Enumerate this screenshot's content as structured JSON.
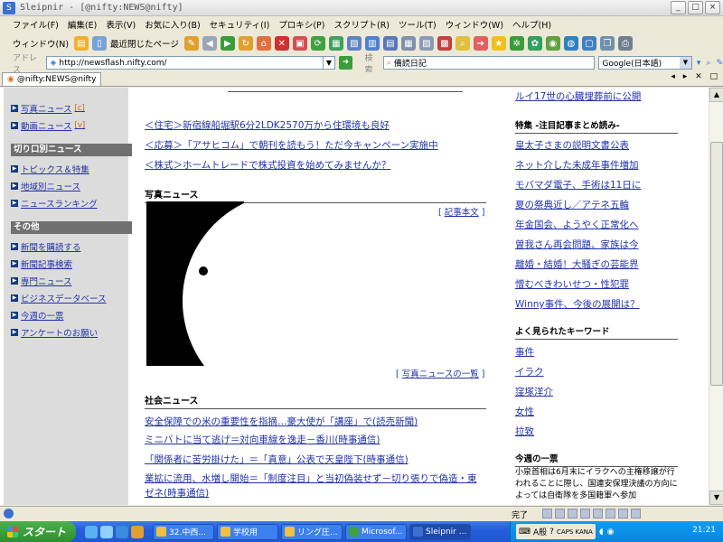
{
  "window": {
    "title": "Sleipnir - [@nifty:NEWS@nifty]",
    "controls": [
      "_",
      "□",
      "×"
    ]
  },
  "menu": [
    "ファイル(F)",
    "編集(E)",
    "表示(V)",
    "お気に入り(B)",
    "セキュリティ(I)",
    "プロキシ(P)",
    "スクリプト(R)",
    "ツール(T)",
    "ウィンドウ(W)",
    "ヘルプ(H)"
  ],
  "toolbar": {
    "window_label": "ウィンドウ(N)",
    "recently_closed_label": "最近閉じたページ"
  },
  "address": {
    "label": "アドレス",
    "url": "http://newsflash.nifty.com/",
    "search_label": "検索",
    "search_value": "備読日記",
    "engine": "Google(日本語)"
  },
  "tab": {
    "label": "@nifty:NEWS@nifty",
    "nav": "◂ ▸ ✕ □"
  },
  "sidebar": {
    "top_links": [
      {
        "label": "写真ニュース",
        "tag": "[c]"
      },
      {
        "label": "動画ニュース",
        "tag": "[v]"
      }
    ],
    "section1_title": "切り口別ニュース",
    "section1_links": [
      "トピックス＆特集",
      "地域別ニュース",
      "ニュースランキング"
    ],
    "section2_title": "その他",
    "section2_links": [
      "新聞を購読する",
      "新聞記事検索",
      "専門ニュース",
      "ビジネスデータベース",
      "今週の一票",
      "アンケートのお願い"
    ]
  },
  "main": {
    "promos": [
      {
        "tag": "＜住宅＞",
        "text": "新宿線船堀駅6分2LDK2570万から住環境も良好"
      },
      {
        "tag": "＜応募＞",
        "text": "「アサヒコム」で朝刊を読もう！ただ今キャンペーン実施中"
      },
      {
        "tag": "＜株式＞",
        "text": "ホームトレードで株式投資を始めてみませんか？"
      }
    ],
    "photo_title": "写真ニュース",
    "article_link": "記事本文",
    "photo_list_link": "写真ニュースの一覧",
    "social_title": "社会ニュース",
    "social_news": [
      "安全保障での米の重要性を指摘…豪大使が「講座」で(読売新聞)",
      "ミニバトに当て逃げ＝対向車線を逸走－香川(時事通信)",
      "「関係者に苦労掛けた」＝「真意」公表で天皇陛下(時事通信)",
      "業拡に流用、水増し開始＝「制度注目」と当初偽装せず－切り張りで偽造・東",
      "ゼネ(時事通信)"
    ]
  },
  "right": {
    "top_cut_link": "ルイ17世の心臓埋葬前に公開",
    "special_title": "特集 -注目記事まとめ読み-",
    "special_links": [
      "皇太子さまの説明文書公表",
      "ネット介した未成年事件増加",
      "モバマダ電子、手術は11日に",
      "夏の祭典近し／アテネ五輪",
      "年金国会、ようやく正常化へ",
      "曽我さん再会問題、家族は今",
      "離婚・結婚！大騒ぎの芸能界",
      "憎むべきわいせつ・性犯罪",
      "Winny事件、今後の展開は？"
    ],
    "keywords_title": "よく見られたキーワード",
    "keywords": [
      "事件",
      "イラク",
      "窪塚洋介",
      "女性",
      "拉致"
    ],
    "vote_title": "今週の一票",
    "vote_text": "小泉首相は6月末にイラクへの主権移譲が行われることに際し、国連安保理決議の方向によっては自衛隊を多国籍軍へ参加"
  },
  "status": {
    "done": "完了"
  },
  "taskbar": {
    "start": "スタート",
    "tasks": [
      "32.中西...",
      "学校用",
      "リング圧...",
      "Microsof...",
      "Sleipnir ..."
    ],
    "ime": "A般",
    "caps": "CAPS KANA",
    "clock": "21:21"
  }
}
